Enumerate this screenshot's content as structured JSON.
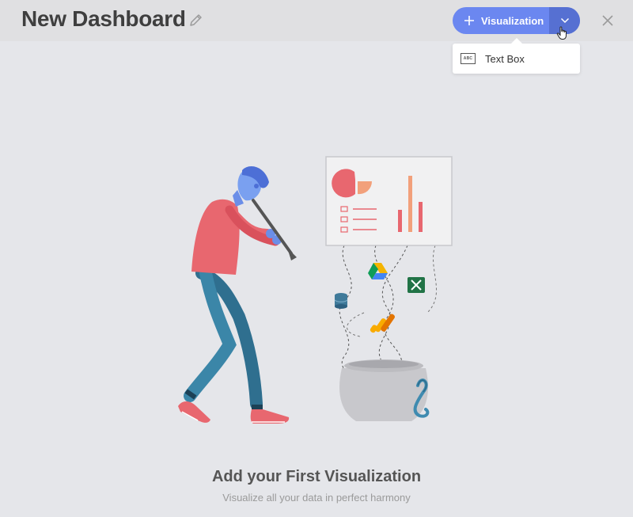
{
  "header": {
    "title": "New Dashboard",
    "visualization_label": "Visualization"
  },
  "dropdown": {
    "items": [
      {
        "label": "Text Box",
        "icon": "text-box-icon",
        "icon_text": "ABC"
      }
    ]
  },
  "empty_state": {
    "title": "Add your First Visualization",
    "subtitle": "Visualize all your data in perfect harmony"
  },
  "colors": {
    "accent": "#6b87f0",
    "accent_dark": "#5670d2",
    "background": "#e5e6ea",
    "header_bg": "#e0e0e2"
  }
}
